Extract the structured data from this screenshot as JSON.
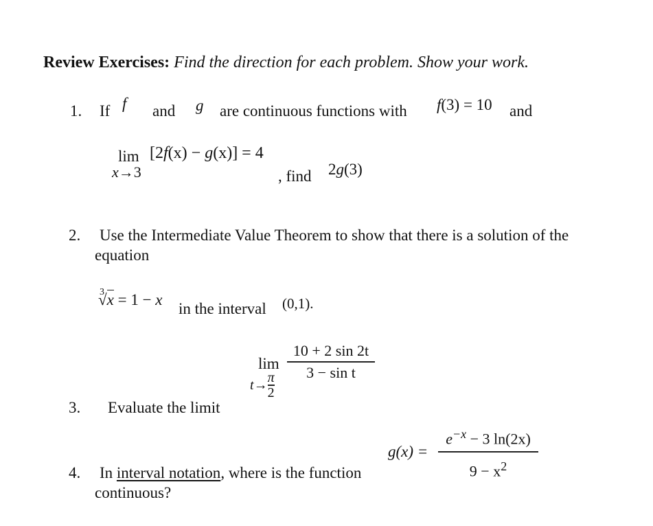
{
  "header": {
    "title_bold": "Review Exercises:",
    "title_italic": "Find the direction for each problem. Show your work."
  },
  "problems": [
    {
      "number": "1.",
      "text_if": "If",
      "var_f": "f",
      "text_and1": "and",
      "var_g": "g",
      "text_cont": "are continuous functions with",
      "given_f": "f",
      "given_arg": "(3) = 10",
      "text_and2": "and",
      "limit_word": "lim",
      "limit_sub": "x→3",
      "limit_expr_open": "[2",
      "limit_expr_f": "f",
      "limit_expr_mid": "(x) − ",
      "limit_expr_g": "g",
      "limit_expr_close": "(x)] = 4",
      "text_find": ", find",
      "find_coef": "2",
      "find_g": "g",
      "find_arg": "(3)"
    },
    {
      "number": "2.",
      "line1": "Use the Intermediate Value Theorem to show that there is a solution of the",
      "line2": "equation",
      "root_index": "3",
      "root_symbol": "√",
      "root_var": "x",
      "eq_rhs": " = 1 − ",
      "eq_rhs_var": "x",
      "text_interval": "in the interval",
      "interval": "(0,1)."
    },
    {
      "number": "3.",
      "text": "Evaluate the limit",
      "limit_word": "lim",
      "limit_var": "t",
      "limit_arrow": "→",
      "limit_to_num": "π",
      "limit_to_den": "2",
      "numerator": "10 + 2 sin 2t",
      "denominator": "3 − sin t"
    },
    {
      "number": "4.",
      "text_in": "In",
      "text_underlined": "interval notation",
      "text_rest": ", where is the function",
      "line2": "continuous?",
      "func_lhs": "g(x) =",
      "func_num_base": "e",
      "func_num_exp": "−x",
      "func_num_rest": " − 3 ln(2x)",
      "func_den_base": "9 − x",
      "func_den_exp": "2"
    }
  ]
}
